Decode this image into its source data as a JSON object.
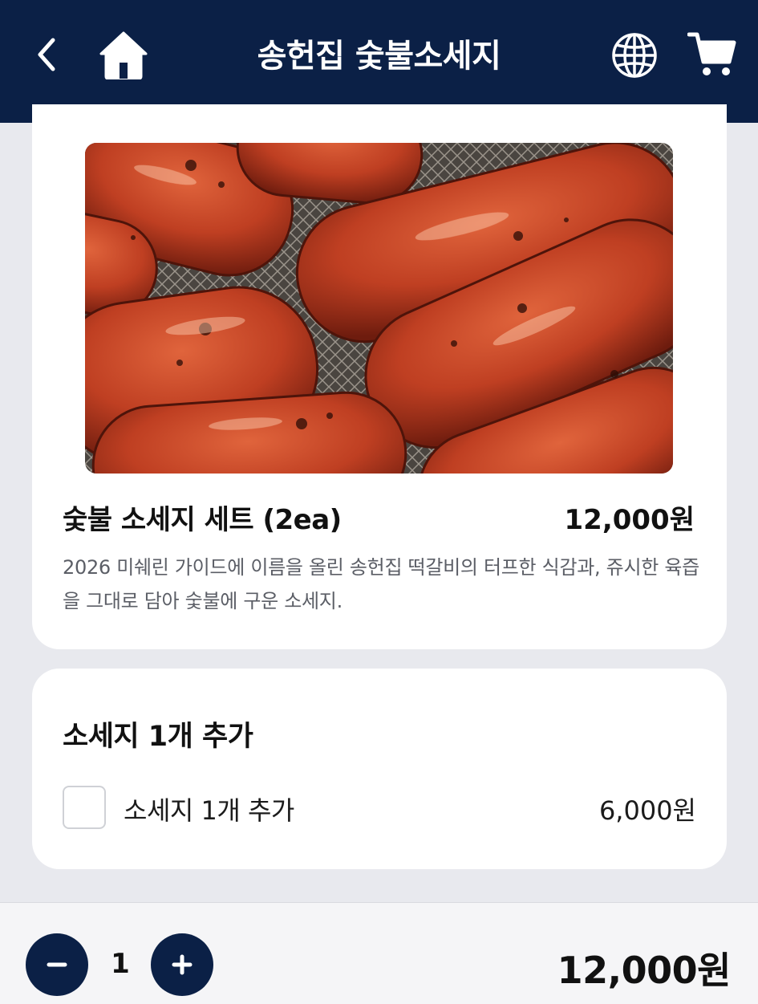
{
  "header": {
    "title": "송헌집 숯불소세지",
    "icons": [
      "chevron-left-icon",
      "home-icon",
      "globe-icon",
      "cart-icon"
    ]
  },
  "product": {
    "name": "숯불 소세지 세트 (2ea)",
    "price": "12,000원",
    "description": "2026 미쉐린 가이드에 이름을 올린 송헌집 떡갈비의 터프한 식감과, 쥬시한 육즙을 그대로 담아 숯불에 구운 소세지."
  },
  "option_group": {
    "title": "소세지 1개 추가",
    "options": [
      {
        "label": "소세지 1개 추가",
        "price": "6,000원",
        "checked": false
      }
    ]
  },
  "footer": {
    "quantity": "1",
    "total": "12,000원"
  },
  "colors": {
    "primary": "#0b2046",
    "background": "#e8e9ee",
    "card": "#ffffff",
    "description_text": "#5b5e66"
  }
}
